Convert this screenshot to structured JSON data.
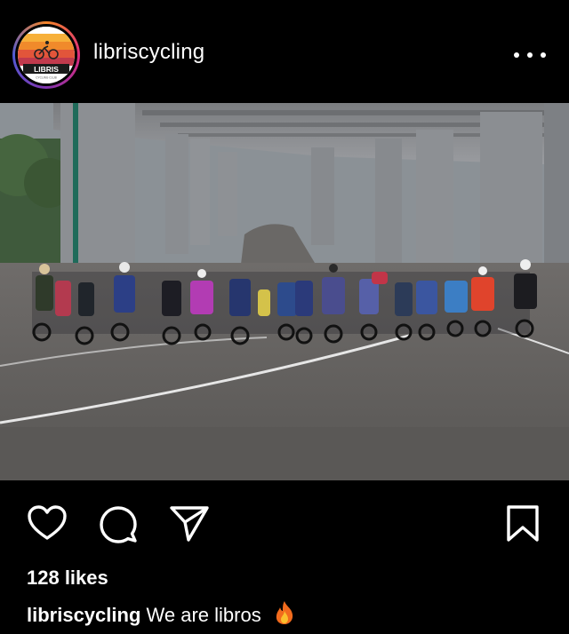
{
  "post": {
    "username": "libriscycling",
    "avatar_icon": "libris-cycling-club-logo",
    "more_icon": "more-horizontal-icon",
    "photo_alt": "",
    "likes_text": "128 likes",
    "caption": {
      "username": "libriscycling",
      "text": "We are libros",
      "emoji_icon": "fire-emoji"
    }
  },
  "actions": [
    "like-icon",
    "comment-icon",
    "share-icon",
    "save-icon"
  ],
  "colors": {
    "background": "#000000",
    "text": "#ffffff"
  }
}
